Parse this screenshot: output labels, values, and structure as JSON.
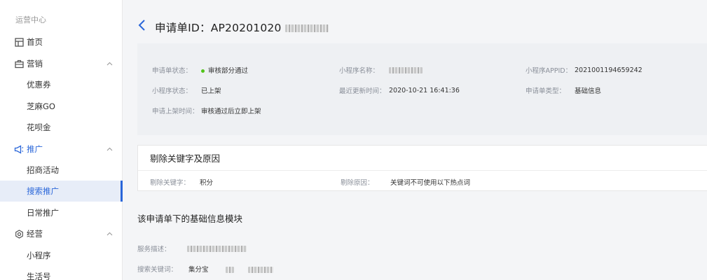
{
  "sidebar": {
    "section_label": "运营中心",
    "items": [
      {
        "label": "首页",
        "icon": "store-icon"
      },
      {
        "label": "营销",
        "icon": "briefcase-icon",
        "chevron": "^"
      },
      {
        "label": "优惠券"
      },
      {
        "label": "芝麻GO"
      },
      {
        "label": "花呗金"
      },
      {
        "label": "推广",
        "icon": "megaphone-icon",
        "chevron": "^"
      },
      {
        "label": "招商活动"
      },
      {
        "label": "搜索推广"
      },
      {
        "label": "日常推广"
      },
      {
        "label": "经营",
        "icon": "settings-icon",
        "chevron": "^"
      },
      {
        "label": "小程序"
      },
      {
        "label": "生活号"
      }
    ]
  },
  "header": {
    "back_glyph": "‹",
    "title": "申请单ID：AP20201020"
  },
  "info": {
    "status_label": "申请单状态：",
    "status_value": "审核部分通过",
    "status_color": "#52c41a",
    "name_label": "小程序名称：",
    "name_value": "",
    "appid_label": "小程序APPID：",
    "appid_value": "2021001194659242",
    "mp_status_label": "小程序状态：",
    "mp_status_value": "已上架",
    "updated_label": "最近更新时间：",
    "updated_value": "2020-10-21 16:41:36",
    "type_label": "申请单类型：",
    "type_value": "基础信息",
    "shelf_label": "申请上架时间：",
    "shelf_value": "审核通过后立即上架"
  },
  "keyword_card": {
    "title": "剔除关键字及原因",
    "kw_label": "剔除关键字：",
    "kw_value": "积分",
    "reason_label": "剔除原因：",
    "reason_value": "关键词不可使用以下热点词"
  },
  "module": {
    "title": "该申请单下的基础信息模块",
    "desc_label": "服务描述：",
    "search_kw_label": "搜索关键词：",
    "search_kw_value": "集分宝"
  },
  "accent_color": "#2a66d9"
}
